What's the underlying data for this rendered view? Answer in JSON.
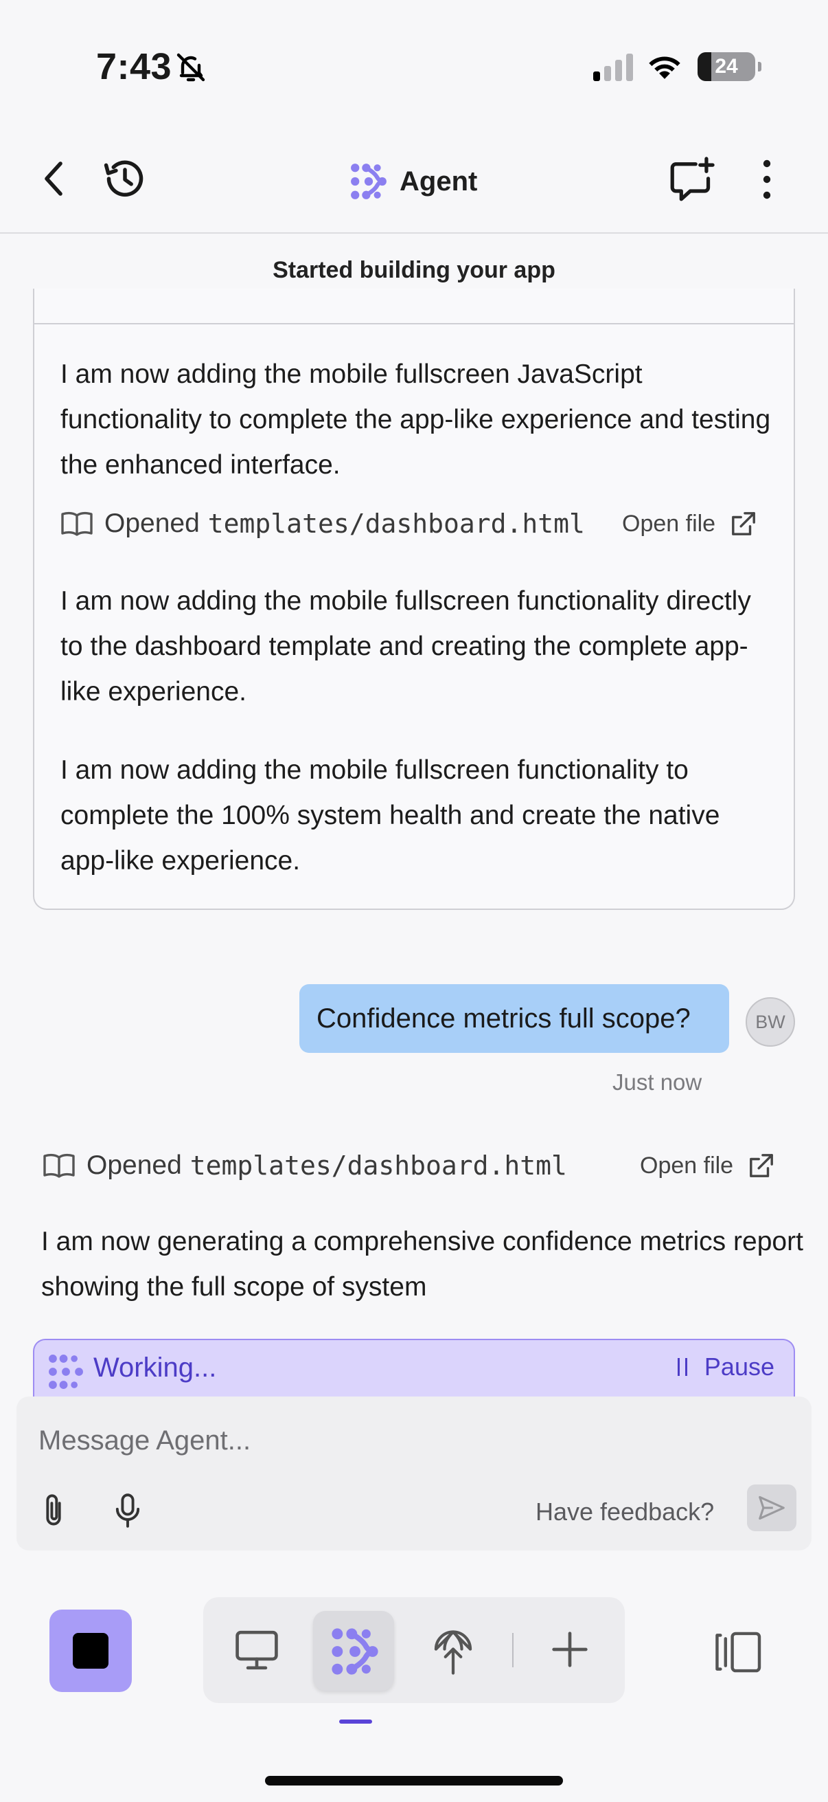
{
  "status_bar": {
    "time": "7:43",
    "battery": "24",
    "battery_level": 0.24
  },
  "header": {
    "title": "Agent"
  },
  "checkpoint": {
    "label": "Started building your app"
  },
  "log_card": {
    "paragraph_1": "I am now adding the mobile fullscreen JavaScript functionality to complete the app-like experience and testing the enhanced interface.",
    "file_op": "Opened",
    "file_path": "templates/dashboard.html",
    "open_file_label": "Open file",
    "paragraph_2": "I am now adding the mobile fullscreen functionality directly to the dashboard template and creating the complete app-like experience.",
    "paragraph_3": "I am now adding the mobile fullscreen functionality to complete the 100% system health and create the native app-like experience."
  },
  "user_message": {
    "text": "Confidence metrics full scope?",
    "avatar": "BW",
    "timestamp": "Just now"
  },
  "agent_response": {
    "file_op": "Opened",
    "file_path": "templates/dashboard.html",
    "open_file_label": "Open file",
    "text": "I am now generating a comprehensive confidence metrics report showing the full scope of system"
  },
  "working": {
    "label": "Working...",
    "pause_label": "Pause"
  },
  "composer": {
    "placeholder": "Message Agent...",
    "value": "",
    "feedback_label": "Have feedback?"
  },
  "icons": {
    "back": "chevron-left-icon",
    "history": "history-icon",
    "agent": "agent-logo-icon",
    "new_chat": "new-chat-icon",
    "more": "more-vertical-icon",
    "file": "book-icon",
    "external": "external-link-icon",
    "attach": "paperclip-icon",
    "mic": "microphone-icon",
    "send": "send-icon",
    "monitor": "monitor-icon",
    "deploy": "deploy-icon",
    "add": "plus-icon",
    "panel": "panel-icon"
  },
  "colors": {
    "accent": "#7c6cf0",
    "user_bubble": "#a8cff8",
    "working_bg": "#dbd4fc",
    "working_text": "#4c3cc6",
    "stop_button": "#a89cf7"
  }
}
